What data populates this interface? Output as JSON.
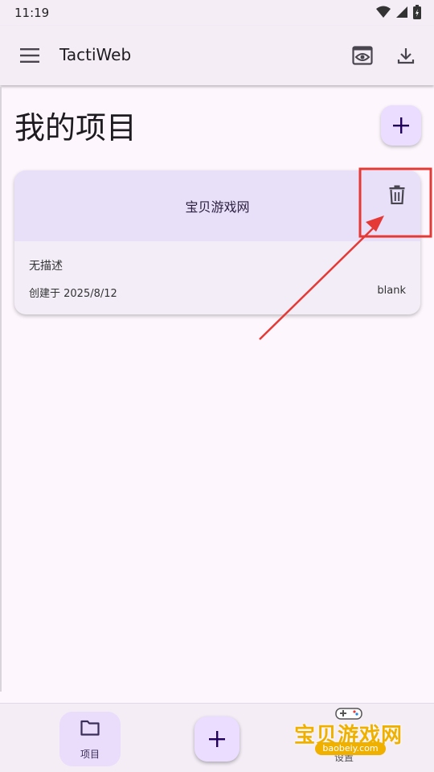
{
  "status_bar": {
    "time": "11:19"
  },
  "app_bar": {
    "title": "TactiWeb",
    "icons": [
      "menu-icon",
      "preview-icon",
      "download-icon"
    ]
  },
  "page": {
    "title": "我的项目"
  },
  "projects": [
    {
      "name": "宝贝游戏网",
      "description": "无描述",
      "created": "创建于 2025/8/12",
      "template": "blank"
    }
  ],
  "bottom_nav": {
    "projects_label": "项目",
    "third_label": "设置"
  },
  "watermark": {
    "text": "宝贝游戏网",
    "url": "baobeiy.com"
  },
  "colors": {
    "accent": "#eaddff",
    "card_header": "#e8dff9",
    "annotation_red": "#e53935"
  }
}
